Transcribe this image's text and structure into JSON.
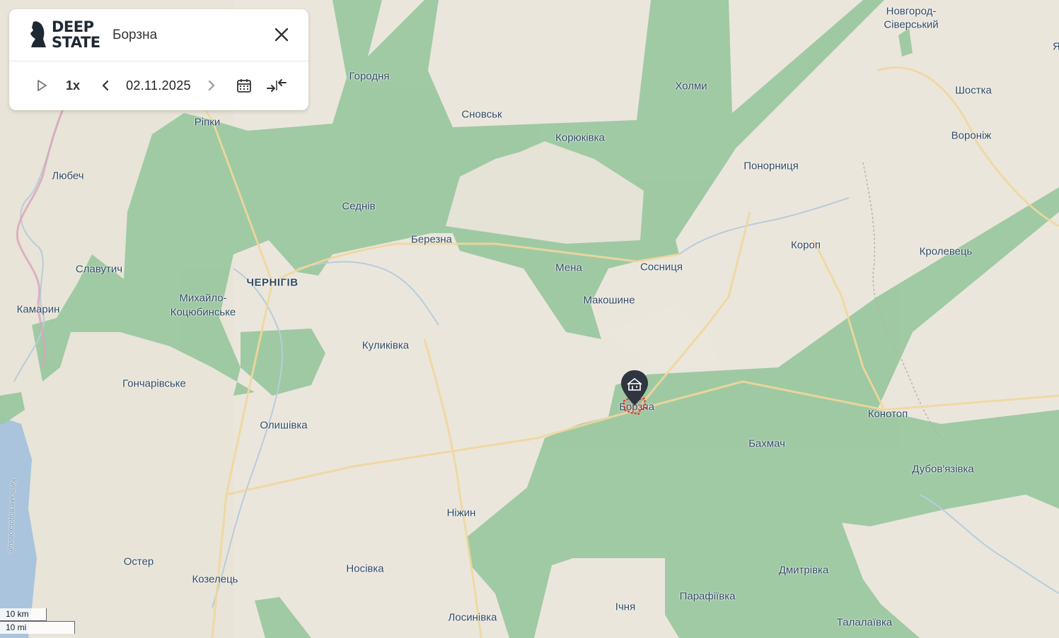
{
  "app": {
    "logo_line1": "DEEP",
    "logo_line2": "STATE",
    "logo_icon": "knight-chess-icon",
    "selected_place": "Борзна",
    "close_icon": "close-icon"
  },
  "timeline": {
    "play_icon": "play-icon",
    "speed": "1x",
    "prev_icon": "chevron-left-icon",
    "date": "02.11.2025",
    "next_icon": "chevron-right-icon",
    "calendar_icon": "calendar-icon",
    "collapse_icon": "collapse-arrows-icon"
  },
  "scale": {
    "km": "10 km",
    "mi": "10 mi"
  },
  "marker": {
    "icon": "town-hall-icon",
    "color": "#2f3640"
  },
  "colors": {
    "land": "#ebe6dc",
    "zone": "#9bc8a0",
    "road": "#f0d79c",
    "river": "#b8ccdc",
    "water": "#a9c4dc",
    "border": "#d9a4b8",
    "marker_highlight": "#e0322f"
  },
  "places": [
    {
      "name": "Новгород-",
      "key": "novhorod1"
    },
    {
      "name": "Сіверський",
      "key": "novhorod2"
    },
    {
      "name": "Городня",
      "key": "horodnia"
    },
    {
      "name": "Холми",
      "key": "kholmy"
    },
    {
      "name": "Шостка",
      "key": "shostka"
    },
    {
      "name": "Рiпки",
      "key": "ripky"
    },
    {
      "name": "Сновськ",
      "key": "snovsk"
    },
    {
      "name": "Корюківка",
      "key": "koriukivka"
    },
    {
      "name": "Вороніж",
      "key": "voronizh"
    },
    {
      "name": "Любеч",
      "key": "liubech"
    },
    {
      "name": "Понорниця",
      "key": "ponornytsia"
    },
    {
      "name": "Седнів",
      "key": "sedniv"
    },
    {
      "name": "Березна",
      "key": "berezna"
    },
    {
      "name": "Короп",
      "key": "korop"
    },
    {
      "name": "Кролевець",
      "key": "krolevets"
    },
    {
      "name": "Славутич",
      "key": "slavutych"
    },
    {
      "name": "Мена",
      "key": "mena"
    },
    {
      "name": "Сосниця",
      "key": "sosnytsia"
    },
    {
      "name": "ЧЕРНІГІВ",
      "key": "chernihiv"
    },
    {
      "name": "Михайло-",
      "key": "mykhailo1"
    },
    {
      "name": "Коцюбинське",
      "key": "mykhailo2"
    },
    {
      "name": "Макошине",
      "key": "makoshyne"
    },
    {
      "name": "Камарин",
      "key": "kamaryn"
    },
    {
      "name": "Куликівка",
      "key": "kulykivka"
    },
    {
      "name": "Гончарівське",
      "key": "honcharivske"
    },
    {
      "name": "Борзна",
      "key": "borzna"
    },
    {
      "name": "Конотоп",
      "key": "konotop"
    },
    {
      "name": "Олишівка",
      "key": "olyshivka"
    },
    {
      "name": "Бахмач",
      "key": "bakhmach"
    },
    {
      "name": "Дубов'язівка",
      "key": "dubovyazivka"
    },
    {
      "name": "Ніжин",
      "key": "nizhyn"
    },
    {
      "name": "Остер",
      "key": "oster"
    },
    {
      "name": "Носівка",
      "key": "nosivka"
    },
    {
      "name": "Дмитрівка",
      "key": "dmytrivka"
    },
    {
      "name": "Козелець",
      "key": "kozelets"
    },
    {
      "name": "Парафіївка",
      "key": "parafiivka"
    },
    {
      "name": "Ічня",
      "key": "ichnia"
    },
    {
      "name": "Лосинівка",
      "key": "losynivka"
    },
    {
      "name": "Талалаївка",
      "key": "talalaivka"
    },
    {
      "name": "Київське водосховище",
      "key": "reservoir"
    },
    {
      "name": "Я",
      "key": "edge_ya"
    }
  ]
}
